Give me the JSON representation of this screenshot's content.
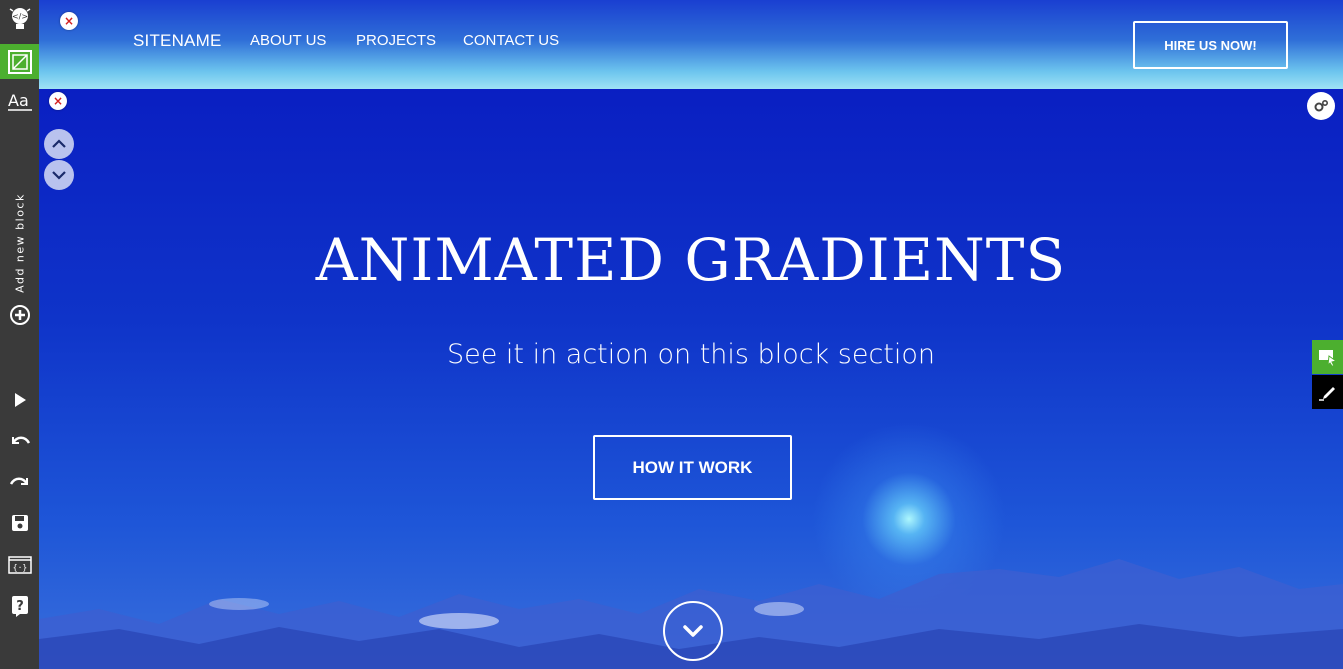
{
  "toolbar": {
    "add_block_label": "Add new block",
    "active_color": "#4caf2f",
    "icons": [
      "lightbulb-icon",
      "wireframe-icon",
      "font-icon",
      "add-circle-icon",
      "play-icon",
      "undo-icon",
      "redo-icon",
      "save-icon",
      "code-icon",
      "help-icon"
    ]
  },
  "nav": {
    "brand": "SITENAME",
    "links": [
      "ABOUT US",
      "PROJECTS",
      "CONTACT US"
    ],
    "cta": "HIRE US NOW!"
  },
  "hero": {
    "title": "ANIMATED GRADIENTS",
    "subtitle": "See it in action on this block section",
    "button": "HOW IT WORK"
  },
  "colors": {
    "hero_top": "#0a1fc2",
    "hero_bottom": "#3a6fdb",
    "toolbar_bg": "#3a3a3a",
    "edit_tab_green": "#4caf2f",
    "close_red": "#d32020"
  },
  "overlay": {
    "close_symbol": "×"
  }
}
